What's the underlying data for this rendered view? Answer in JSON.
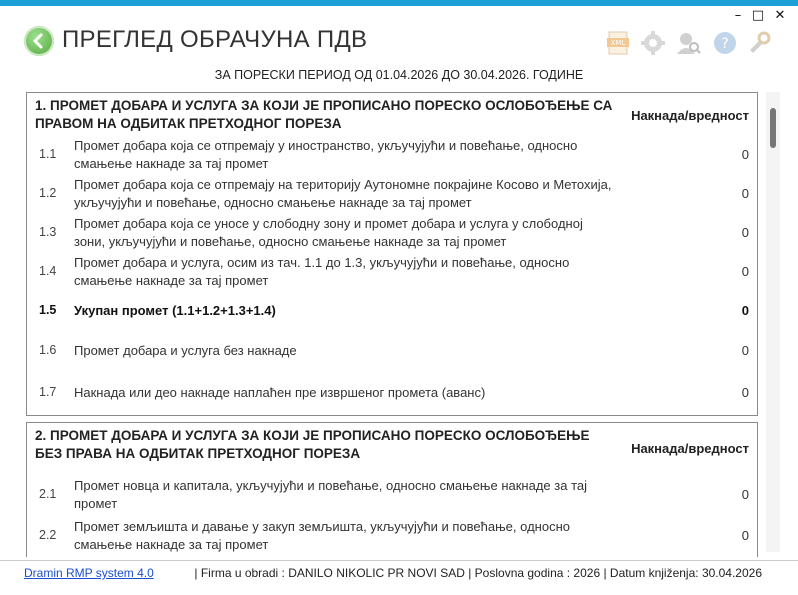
{
  "window": {
    "minimize": "–",
    "maximize": "□",
    "close": "✕"
  },
  "header": {
    "title": "ПРЕГЛЕД ОБРАЧУНА ПДВ",
    "toolbar_icons": [
      "xml-export-icon",
      "settings-gear-icon",
      "user-search-icon",
      "help-icon",
      "tools-icon"
    ],
    "toolbar_text": {
      "xml": "XML"
    }
  },
  "period": "ЗА ПОРЕСКИ ПЕРИОД ОД 01.04.2026 ДО 30.04.2026. ГОДИНЕ",
  "section1": {
    "title": "1. ПРОМЕТ ДОБАРА И УСЛУГА ЗА КОЈИ ЈЕ ПРОПИСАНО ПОРЕСКО ОСЛОБОЂЕЊЕ СА ПРАВОМ НА ОДБИТАК ПРЕТХОДНОГ ПОРЕЗА",
    "col_header": "Накнада/вредност",
    "rows": [
      {
        "num": "1.1",
        "desc": "Промет добара која се отпремају у иностранство, укључујући и повећање, односно смањење накнаде за тај промет",
        "val": "0"
      },
      {
        "num": "1.2",
        "desc": "Промет добара која се отпремају на територију Аутономне покрајине Косово и Метохија, укључујући и повећање, односно смањење накнаде за тај промет",
        "val": "0"
      },
      {
        "num": "1.3",
        "desc": "Промет добара која се уносе у слободну зону и промет добара и услуга у слободној зони, укључујући и повећање, односно смањење накнаде за тај промет",
        "val": "0"
      },
      {
        "num": "1.4",
        "desc": "Промет добара и услуга, осим из тач. 1.1 до 1.3, укључујући и повећање, односно смањење накнаде за тај промет",
        "val": "0"
      },
      {
        "num": "1.5",
        "desc": "Укупан промет (1.1+1.2+1.3+1.4)",
        "val": "0"
      },
      {
        "num": "1.6",
        "desc": "Промет добара и услуга без накнаде",
        "val": "0"
      },
      {
        "num": "1.7",
        "desc": "Накнада или део накнаде наплаћен пре извршеног промета (аванс)",
        "val": "0"
      }
    ]
  },
  "section2": {
    "title": "2. ПРОМЕТ ДОБАРА И УСЛУГА ЗА КОЈИ ЈЕ ПРОПИСАНО ПОРЕСКО ОСЛОБОЂЕЊЕ БЕЗ ПРАВА НА ОДБИТАК ПРЕТХОДНОГ ПОРЕЗА",
    "col_header": "Накнада/вредност",
    "rows": [
      {
        "num": "2.1",
        "desc": "Промет новца и капитала, укључујући и повећање, односно смањење накнаде за тај промет",
        "val": "0"
      },
      {
        "num": "2.2",
        "desc": "Промет земљишта и давање у закуп земљишта, укључујући и повећање, односно смањење накнаде за тај промет",
        "val": "0"
      }
    ]
  },
  "status": {
    "link": "Dramin RMP system 4.0",
    "info": "| Firma u obradi : DANILO NIKOLIC PR NOVI SAD  |  Poslovna godina : 2026  |  Datum knjiženja: 30.04.2026"
  },
  "colors": {
    "accent": "#1e9fd6",
    "back_button": "#5cb84a",
    "link": "#1a4fd0"
  }
}
